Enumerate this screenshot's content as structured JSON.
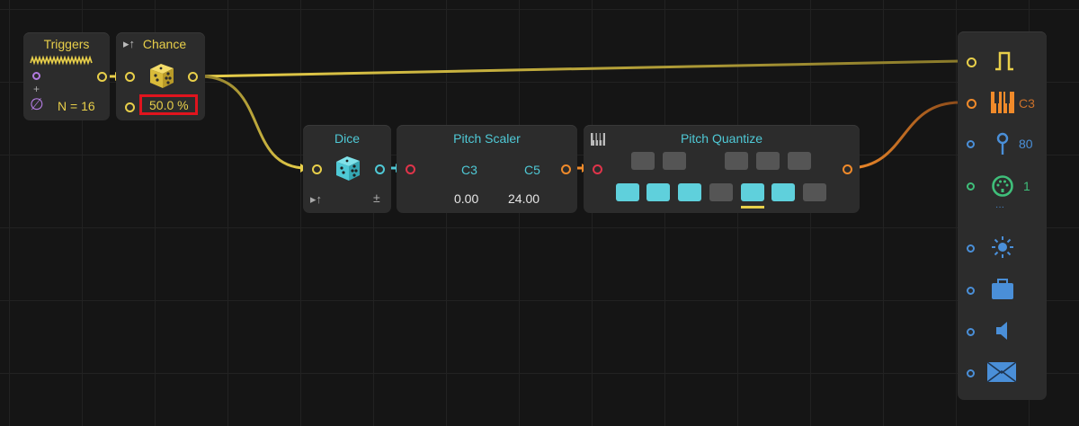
{
  "triggers": {
    "title": "Triggers",
    "count_label": "N = 16",
    "plus": "+",
    "empty_symbol": "∅"
  },
  "chance": {
    "title": "Chance",
    "title_prefix": "▸↑",
    "value": "50.0 %"
  },
  "dice": {
    "title": "Dice",
    "mode_left": "▸↑",
    "mode_right": "±"
  },
  "pitch_scaler": {
    "title": "Pitch Scaler",
    "low_note": "C3",
    "high_note": "C5",
    "low_value": "0.00",
    "high_value": "24.00"
  },
  "pitch_quantize": {
    "title": "Pitch Quantize",
    "black_keys": [
      "off",
      "off",
      "off",
      "off",
      "off"
    ],
    "white_keys": [
      "on",
      "on",
      "on",
      "off",
      "on",
      "on",
      "off"
    ]
  },
  "outputs": {
    "note": "C3",
    "velocity": "80",
    "channel": "1",
    "more": "···"
  },
  "colors": {
    "yellow": "#e8cf4a",
    "cyan": "#4fc9d6",
    "orange": "#f08a2a",
    "red_highlight": "#e0141e"
  }
}
